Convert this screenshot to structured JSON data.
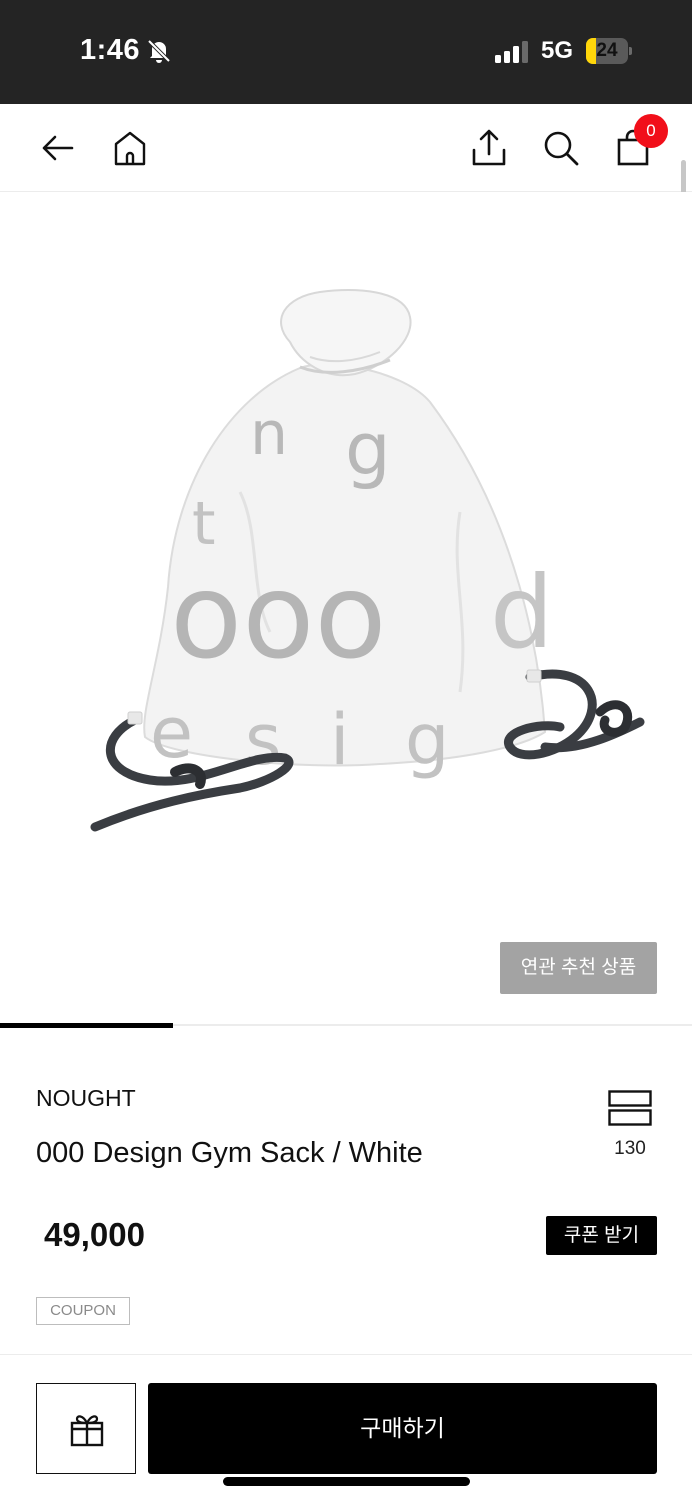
{
  "status_bar": {
    "time": "1:46",
    "network": "5G",
    "battery_level": "24",
    "battery_fraction": 0.24,
    "battery_color": "#ffd60a",
    "icons": [
      "bell-slash-icon",
      "signal-icon"
    ]
  },
  "nav": {
    "cart_count": "0",
    "badge_color": "#f10f1a",
    "icons": [
      "back-arrow-icon",
      "home-icon",
      "share-icon",
      "search-icon",
      "shopping-bag-icon"
    ]
  },
  "gallery": {
    "related_label": "연관 추천 상품",
    "image_text_fragments": [
      "n",
      "g",
      "t",
      "ooo",
      "d",
      "e",
      "s",
      "i",
      "g",
      "n"
    ]
  },
  "product": {
    "brand": "NOUGHT",
    "title": "000 Design Gym Sack / White",
    "view_count": "130",
    "price": "49,000",
    "coupon_button": "쿠폰 받기",
    "coupon_tag": "COUPON"
  },
  "bottom_bar": {
    "buy_label": "구매하기",
    "icons": [
      "gift-icon"
    ]
  }
}
